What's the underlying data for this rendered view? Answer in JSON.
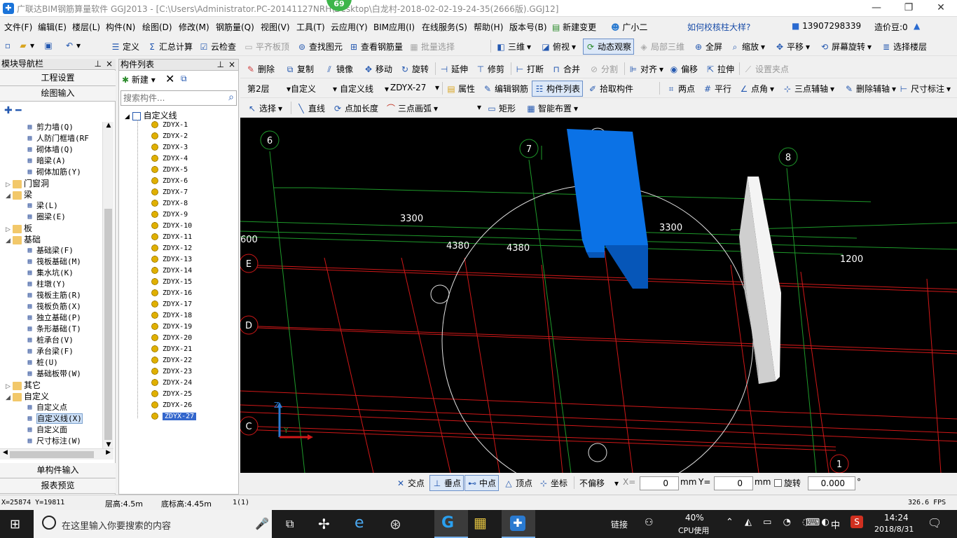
{
  "window": {
    "title": "广联达BIM钢筋算量软件 GGJ2013 - [C:\\Users\\Administrator.PC-20141127NRH\\Desktop\\白龙村-2018-02-02-19-24-35(2666版).GGJ12]",
    "badge": "69",
    "controls": {
      "minimize": "—",
      "restore": "❐",
      "close": "✕"
    }
  },
  "menu": {
    "items": [
      "文件(F)",
      "编辑(E)",
      "楼层(L)",
      "构件(N)",
      "绘图(D)",
      "修改(M)",
      "钢筋量(Q)",
      "视图(V)",
      "工具(T)",
      "云应用(Y)",
      "BIM应用(I)",
      "在线服务(S)",
      "帮助(H)",
      "版本号(B)",
      "新建变更",
      "广小二"
    ],
    "help_link": "如何校核柱大样?",
    "phone": "13907298339",
    "cost_beans": "造价豆:0"
  },
  "toolbar1": {
    "items": [
      "定义",
      "汇总计算",
      "云检查",
      "平齐板顶",
      "查找图元",
      "查看钢筋量",
      "批量选择",
      "三维",
      "俯视",
      "动态观察",
      "局部三维",
      "全屏",
      "缩放",
      "平移",
      "屏幕旋转",
      "选择楼层"
    ]
  },
  "toolbar2": {
    "items": [
      "删除",
      "复制",
      "镜像",
      "移动",
      "旋转",
      "延伸",
      "修剪",
      "打断",
      "合并",
      "分割",
      "对齐",
      "偏移",
      "拉伸",
      "设置夹点"
    ]
  },
  "toolbar3": {
    "floor": "第2层",
    "category": "自定义",
    "subtype": "自定义线",
    "component": "ZDYX-27",
    "items": [
      "属性",
      "编辑钢筋",
      "构件列表",
      "拾取构件",
      "两点",
      "平行",
      "点角",
      "三点辅轴",
      "删除辅轴",
      "尺寸标注"
    ]
  },
  "toolbar4": {
    "items": [
      "选择",
      "直线",
      "点加长度",
      "三点画弧",
      "矩形",
      "智能布置"
    ]
  },
  "leftnav": {
    "title": "模块导航栏",
    "pin": "📌",
    "buttons": {
      "project_settings": "工程设置",
      "drawing_input": "绘图输入",
      "single_input": "单构件输入",
      "report_preview": "报表预览"
    },
    "tree": [
      {
        "label": "剪力墙(Q)",
        "level": 2,
        "kind": "leaf"
      },
      {
        "label": "人防门框墙(RF",
        "level": 2,
        "kind": "leaf"
      },
      {
        "label": "砌体墙(Q)",
        "level": 2,
        "kind": "leaf"
      },
      {
        "label": "暗梁(A)",
        "level": 2,
        "kind": "leaf"
      },
      {
        "label": "砌体加筋(Y)",
        "level": 2,
        "kind": "leaf"
      },
      {
        "label": "门窗洞",
        "level": 1,
        "kind": "folder",
        "exp": "▷"
      },
      {
        "label": "梁",
        "level": 1,
        "kind": "folder",
        "exp": "◢"
      },
      {
        "label": "梁(L)",
        "level": 2,
        "kind": "leaf"
      },
      {
        "label": "圈梁(E)",
        "level": 2,
        "kind": "leaf"
      },
      {
        "label": "板",
        "level": 1,
        "kind": "folder",
        "exp": "▷"
      },
      {
        "label": "基础",
        "level": 1,
        "kind": "folder",
        "exp": "◢"
      },
      {
        "label": "基础梁(F)",
        "level": 2,
        "kind": "leaf"
      },
      {
        "label": "筏板基础(M)",
        "level": 2,
        "kind": "leaf"
      },
      {
        "label": "集水坑(K)",
        "level": 2,
        "kind": "leaf"
      },
      {
        "label": "柱墩(Y)",
        "level": 2,
        "kind": "leaf"
      },
      {
        "label": "筏板主筋(R)",
        "level": 2,
        "kind": "leaf"
      },
      {
        "label": "筏板负筋(X)",
        "level": 2,
        "kind": "leaf"
      },
      {
        "label": "独立基础(P)",
        "level": 2,
        "kind": "leaf"
      },
      {
        "label": "条形基础(T)",
        "level": 2,
        "kind": "leaf"
      },
      {
        "label": "桩承台(V)",
        "level": 2,
        "kind": "leaf"
      },
      {
        "label": "承台梁(F)",
        "level": 2,
        "kind": "leaf"
      },
      {
        "label": "桩(U)",
        "level": 2,
        "kind": "leaf"
      },
      {
        "label": "基础板带(W)",
        "level": 2,
        "kind": "leaf"
      },
      {
        "label": "其它",
        "level": 1,
        "kind": "folder",
        "exp": "▷"
      },
      {
        "label": "自定义",
        "level": 1,
        "kind": "folder",
        "exp": "◢"
      },
      {
        "label": "自定义点",
        "level": 2,
        "kind": "leaf"
      },
      {
        "label": "自定义线(X)",
        "level": 2,
        "kind": "leaf",
        "selected": true
      },
      {
        "label": "自定义面",
        "level": 2,
        "kind": "leaf"
      },
      {
        "label": "尺寸标注(W)",
        "level": 2,
        "kind": "leaf"
      }
    ]
  },
  "complist": {
    "title": "构件列表",
    "new_label": "新建",
    "search_placeholder": "搜索构件...",
    "root": "自定义线",
    "items": [
      "ZDYX-1",
      "ZDYX-2",
      "ZDYX-3",
      "ZDYX-4",
      "ZDYX-5",
      "ZDYX-6",
      "ZDYX-7",
      "ZDYX-8",
      "ZDYX-9",
      "ZDYX-10",
      "ZDYX-11",
      "ZDYX-12",
      "ZDYX-13",
      "ZDYX-14",
      "ZDYX-15",
      "ZDYX-16",
      "ZDYX-17",
      "ZDYX-18",
      "ZDYX-19",
      "ZDYX-20",
      "ZDYX-21",
      "ZDYX-22",
      "ZDYX-23",
      "ZDYX-24",
      "ZDYX-25",
      "ZDYX-26",
      "ZDYX-27"
    ],
    "selected": "ZDYX-27"
  },
  "viewport": {
    "axis_labels": [
      "6",
      "7",
      "8",
      "E",
      "D",
      "C",
      "1"
    ],
    "dimensions": [
      "3300",
      "3300",
      "4380",
      "4380",
      "1200",
      "600"
    ],
    "axis_triad": {
      "z": "Z",
      "y": "Y"
    },
    "colors": {
      "background": "#000000",
      "grid_green": "#1e9a2a",
      "grid_red": "#d01818",
      "element_blue": "#0b72e6",
      "element_white": "#e8e8e8"
    }
  },
  "snapbar": {
    "items": [
      "交点",
      "垂点",
      "中点",
      "顶点",
      "坐标"
    ],
    "offset_mode": "不偏移",
    "x_label": "X=",
    "x_value": "0",
    "y_label": "Y=",
    "y_value": "0",
    "unit": "mm",
    "rotate_label": "旋转",
    "rotate_value": "0.000",
    "degree": "°"
  },
  "status": {
    "coords": "X=25874 Y=19811",
    "floor_height": "层高:4.5m",
    "bottom_height": "底标高:4.45m",
    "count": "1(1)",
    "fps": "326.6 FPS"
  },
  "taskbar": {
    "search_placeholder": "在这里输入你要搜索的内容",
    "link_label": "链接",
    "cpu_percent": "40%",
    "cpu_label": "CPU使用",
    "ime": "中",
    "time": "14:24",
    "date": "2018/8/31"
  }
}
